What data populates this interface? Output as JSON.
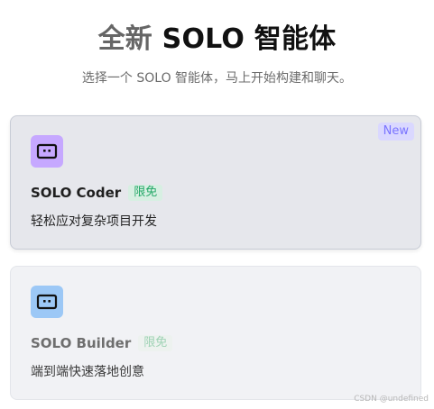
{
  "header": {
    "title_prefix": "全新",
    "title_main": "SOLO 智能体",
    "subtitle": "选择一个 SOLO 智能体，马上开始构建和聊天。"
  },
  "cards": [
    {
      "badge": "New",
      "icon": "robot-icon",
      "name": "SOLO Coder",
      "tag": "限免",
      "description": "轻松应对复杂项目开发",
      "accent": "#c6a8ff",
      "selected": true
    },
    {
      "icon": "robot-icon",
      "name": "SOLO Builder",
      "tag": "限免",
      "description": "端到端快速落地创意",
      "accent": "#9cc8f6",
      "selected": false
    }
  ],
  "watermark": "CSDN @undefined"
}
